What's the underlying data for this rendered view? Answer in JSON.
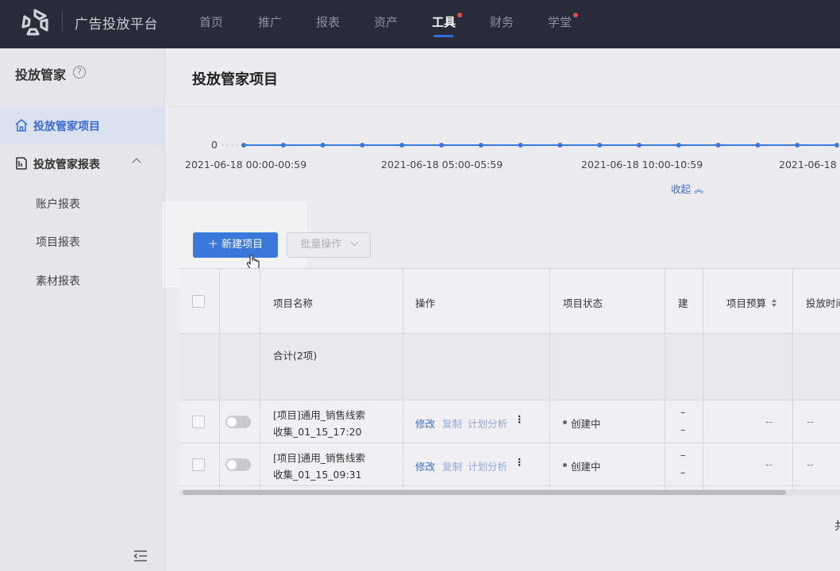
{
  "nav": {
    "brand": "广告投放平台",
    "items": [
      {
        "label": "首页",
        "active": false,
        "dot": false
      },
      {
        "label": "推广",
        "active": false,
        "dot": false
      },
      {
        "label": "报表",
        "active": false,
        "dot": false
      },
      {
        "label": "资产",
        "active": false,
        "dot": false
      },
      {
        "label": "工具",
        "active": true,
        "dot": true
      },
      {
        "label": "财务",
        "active": false,
        "dot": false
      },
      {
        "label": "学堂",
        "active": false,
        "dot": true
      }
    ],
    "accent_color": "#2f6fdc",
    "dot_color": "#e34d4d"
  },
  "sidebar": {
    "title": "投放管家",
    "help_icon": "?",
    "items": [
      {
        "label": "投放管家项目",
        "icon": "home-icon",
        "active": true
      },
      {
        "label": "投放管家报表",
        "icon": "report-icon",
        "active": false,
        "expanded": true
      }
    ],
    "sub_items": [
      "账户报表",
      "项目报表",
      "素材报表"
    ]
  },
  "main": {
    "page_title": "投放管家项目",
    "chart": {
      "y_tick": "0",
      "x_ticks": [
        "2021-06-18 00:00-00:59",
        "2021-06-18 05:00-05:59",
        "2021-06-18 10:00-10:59",
        "2021-06-18"
      ],
      "collapse_label": "收起"
    },
    "buttons": {
      "new_project": "新建项目",
      "batch_ops": "批量操作"
    },
    "table": {
      "headers": [
        "项目名称",
        "操作",
        "项目状态",
        "建",
        "项目预算",
        "投放时间"
      ],
      "total_label": "合计(2项)",
      "rows": [
        {
          "name_line1": "[项目]通用_销售线索",
          "name_line2": "收集_01_15_17:20",
          "ops": [
            "修改",
            "复制",
            "计划分析"
          ],
          "status": "创建中",
          "col4_line1": "–",
          "col4_line2": "–",
          "budget": "--",
          "time": "--"
        },
        {
          "name_line1": "[项目]通用_销售线索",
          "name_line2": "收集_01_15_09:31",
          "ops": [
            "修改",
            "复制",
            "计划分析"
          ],
          "status": "创建中",
          "col4_line1": "–",
          "col4_line2": "–",
          "budget": "--",
          "time": "--"
        }
      ]
    },
    "footer_fragment": "共"
  },
  "chart_data": {
    "type": "line",
    "x": [
      "00:00",
      "01:00",
      "02:00",
      "03:00",
      "04:00",
      "05:00",
      "06:00",
      "07:00",
      "08:00",
      "09:00",
      "10:00",
      "11:00",
      "12:00",
      "13:00",
      "14:00",
      "15:00"
    ],
    "series": [
      {
        "values": [
          0,
          0,
          0,
          0,
          0,
          0,
          0,
          0,
          0,
          0,
          0,
          0,
          0,
          0,
          0,
          0
        ],
        "color": "#3a79db"
      }
    ],
    "ylim": [
      0,
      1
    ]
  }
}
